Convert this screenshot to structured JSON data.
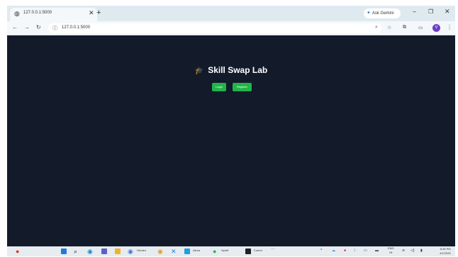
{
  "browser": {
    "tab": {
      "title": "127.0.0.1:5000",
      "favicon": "globe-icon"
    },
    "new_tab": "+",
    "ask_gemini": "Ask Gemini",
    "url": "127.0.0.1:5000",
    "window_controls": {
      "minimize": "–",
      "maximize": "❐",
      "close": "✕"
    }
  },
  "app": {
    "title": "Skill Swap Lab",
    "buttons": {
      "login": "Login",
      "register": "Register"
    },
    "colors": {
      "background": "#131a2a",
      "button": "#22b34a"
    }
  },
  "taskbar": {
    "apps": [
      {
        "name": "start",
        "label": ""
      },
      {
        "name": "search",
        "label": ""
      },
      {
        "name": "edge",
        "label": ""
      },
      {
        "name": "teams",
        "label": ""
      },
      {
        "name": "file-explorer",
        "label": ""
      },
      {
        "name": "chrome-gemini",
        "label": "Gemini"
      },
      {
        "name": "chrome",
        "label": ""
      },
      {
        "name": "vscode",
        "label": ""
      },
      {
        "name": "alexa",
        "label": "Alexa"
      },
      {
        "name": "spotify",
        "label": "Spotif"
      },
      {
        "name": "terminal",
        "label": "Comm"
      }
    ],
    "more": "···",
    "tray": {
      "lang_top": "ENG",
      "lang_bottom": "IN"
    },
    "clock": {
      "time": "8:48 PM",
      "date": "4/1/2026"
    }
  }
}
